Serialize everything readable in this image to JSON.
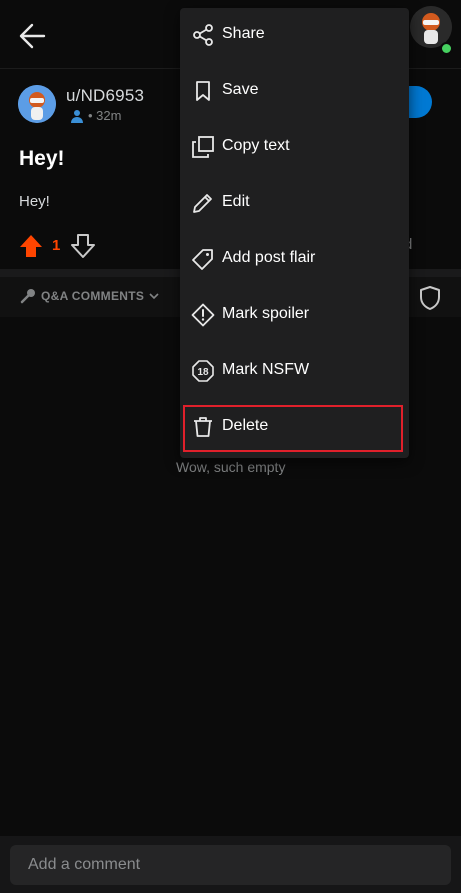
{
  "header": {
    "back_icon": "arrow-left-icon"
  },
  "post": {
    "username": "u/ND6953",
    "time": "• 32m",
    "title": "Hey!",
    "body": "Hey!",
    "score": "1",
    "share_peek": "",
    "awards_peek": "d"
  },
  "comments": {
    "sort_label": "Q&A COMMENTS",
    "empty_text": "Wow, such empty"
  },
  "composer": {
    "placeholder": "Add a comment"
  },
  "menu": {
    "items": [
      {
        "label": "Share",
        "icon": "share-icon"
      },
      {
        "label": "Save",
        "icon": "bookmark-icon"
      },
      {
        "label": "Copy text",
        "icon": "copy-icon"
      },
      {
        "label": "Edit",
        "icon": "pencil-icon"
      },
      {
        "label": "Add post flair",
        "icon": "tag-icon"
      },
      {
        "label": "Mark spoiler",
        "icon": "alert-icon"
      },
      {
        "label": "Mark NSFW",
        "icon": "nsfw-18-icon"
      },
      {
        "label": "Delete",
        "icon": "trash-icon"
      }
    ],
    "highlighted_item": "Delete"
  },
  "colors": {
    "background": "#0b0b0b",
    "menu": "#1f1f20",
    "upvote": "#ff4500",
    "join": "#0079d3",
    "highlight": "#e0202b",
    "online": "#46d160"
  }
}
